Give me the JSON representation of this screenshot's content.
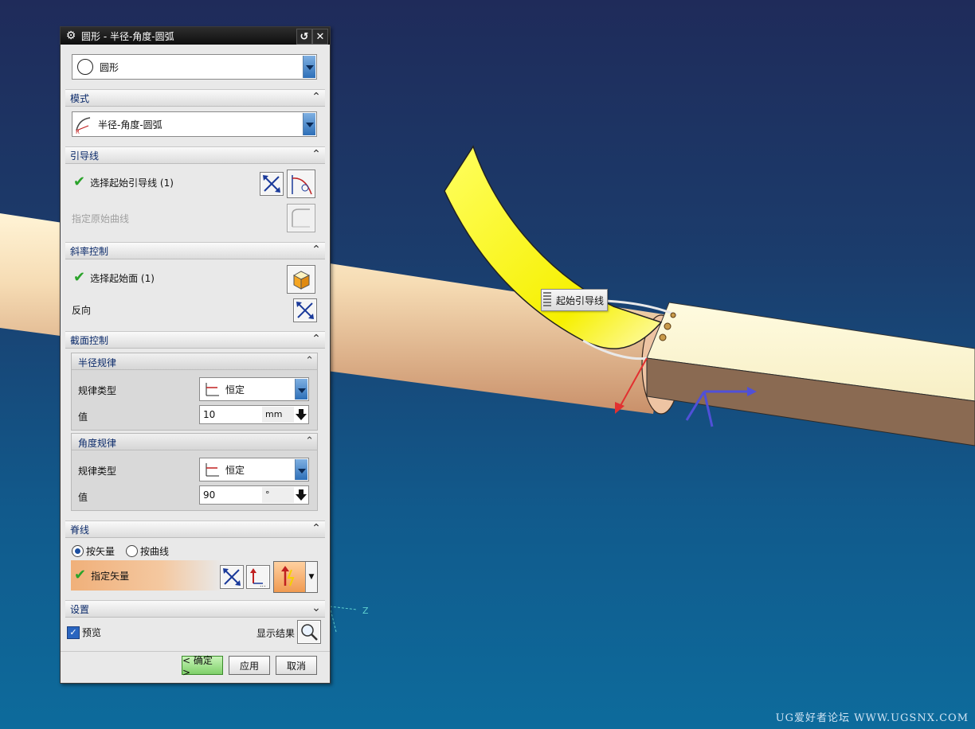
{
  "dialog": {
    "title": "圆形 - 半径-角度-圆弧",
    "type_select": "圆形",
    "sections": {
      "mode": {
        "label": "模式",
        "select": "半径-角度-圆弧"
      },
      "guide": {
        "label": "引导线",
        "select_start": "选择起始引导线 (1)",
        "specify_curve": "指定原始曲线"
      },
      "slope": {
        "label": "斜率控制",
        "select_face": "选择起始面 (1)",
        "reverse": "反向"
      },
      "section_control": {
        "label": "截面控制",
        "radius_law": {
          "label": "半径规律",
          "law_type_label": "规律类型",
          "law_type": "恒定",
          "value_label": "值",
          "value": "10",
          "unit": "mm"
        },
        "angle_law": {
          "label": "角度规律",
          "law_type_label": "规律类型",
          "law_type": "恒定",
          "value_label": "值",
          "value": "90",
          "unit": "°"
        }
      },
      "spine": {
        "label": "脊线",
        "option_vector": "按矢量",
        "option_curve": "按曲线",
        "specify_vector": "指定矢量"
      },
      "settings": {
        "label": "设置"
      }
    },
    "preview_label": "预览",
    "show_result_label": "显示结果",
    "buttons": {
      "ok": "< 确定 >",
      "apply": "应用",
      "cancel": "取消"
    }
  },
  "viewport": {
    "tooltip": "起始引导线",
    "axis_label": "Z"
  },
  "watermark": "UG爱好者论坛 WWW.UGSNX.COM",
  "colors": {
    "accent_blue": "#2d6fb8",
    "check_green": "#2aa32a",
    "surface_yellow": "#f4f000"
  }
}
